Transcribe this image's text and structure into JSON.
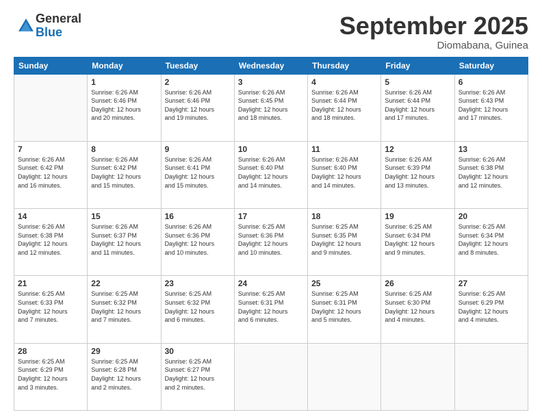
{
  "logo": {
    "general": "General",
    "blue": "Blue"
  },
  "header": {
    "month": "September 2025",
    "location": "Diomabana, Guinea"
  },
  "days_of_week": [
    "Sunday",
    "Monday",
    "Tuesday",
    "Wednesday",
    "Thursday",
    "Friday",
    "Saturday"
  ],
  "weeks": [
    [
      {
        "day": "",
        "info": ""
      },
      {
        "day": "1",
        "info": "Sunrise: 6:26 AM\nSunset: 6:46 PM\nDaylight: 12 hours\nand 20 minutes."
      },
      {
        "day": "2",
        "info": "Sunrise: 6:26 AM\nSunset: 6:46 PM\nDaylight: 12 hours\nand 19 minutes."
      },
      {
        "day": "3",
        "info": "Sunrise: 6:26 AM\nSunset: 6:45 PM\nDaylight: 12 hours\nand 18 minutes."
      },
      {
        "day": "4",
        "info": "Sunrise: 6:26 AM\nSunset: 6:44 PM\nDaylight: 12 hours\nand 18 minutes."
      },
      {
        "day": "5",
        "info": "Sunrise: 6:26 AM\nSunset: 6:44 PM\nDaylight: 12 hours\nand 17 minutes."
      },
      {
        "day": "6",
        "info": "Sunrise: 6:26 AM\nSunset: 6:43 PM\nDaylight: 12 hours\nand 17 minutes."
      }
    ],
    [
      {
        "day": "7",
        "info": "Sunrise: 6:26 AM\nSunset: 6:42 PM\nDaylight: 12 hours\nand 16 minutes."
      },
      {
        "day": "8",
        "info": "Sunrise: 6:26 AM\nSunset: 6:42 PM\nDaylight: 12 hours\nand 15 minutes."
      },
      {
        "day": "9",
        "info": "Sunrise: 6:26 AM\nSunset: 6:41 PM\nDaylight: 12 hours\nand 15 minutes."
      },
      {
        "day": "10",
        "info": "Sunrise: 6:26 AM\nSunset: 6:40 PM\nDaylight: 12 hours\nand 14 minutes."
      },
      {
        "day": "11",
        "info": "Sunrise: 6:26 AM\nSunset: 6:40 PM\nDaylight: 12 hours\nand 14 minutes."
      },
      {
        "day": "12",
        "info": "Sunrise: 6:26 AM\nSunset: 6:39 PM\nDaylight: 12 hours\nand 13 minutes."
      },
      {
        "day": "13",
        "info": "Sunrise: 6:26 AM\nSunset: 6:38 PM\nDaylight: 12 hours\nand 12 minutes."
      }
    ],
    [
      {
        "day": "14",
        "info": "Sunrise: 6:26 AM\nSunset: 6:38 PM\nDaylight: 12 hours\nand 12 minutes."
      },
      {
        "day": "15",
        "info": "Sunrise: 6:26 AM\nSunset: 6:37 PM\nDaylight: 12 hours\nand 11 minutes."
      },
      {
        "day": "16",
        "info": "Sunrise: 6:26 AM\nSunset: 6:36 PM\nDaylight: 12 hours\nand 10 minutes."
      },
      {
        "day": "17",
        "info": "Sunrise: 6:25 AM\nSunset: 6:36 PM\nDaylight: 12 hours\nand 10 minutes."
      },
      {
        "day": "18",
        "info": "Sunrise: 6:25 AM\nSunset: 6:35 PM\nDaylight: 12 hours\nand 9 minutes."
      },
      {
        "day": "19",
        "info": "Sunrise: 6:25 AM\nSunset: 6:34 PM\nDaylight: 12 hours\nand 9 minutes."
      },
      {
        "day": "20",
        "info": "Sunrise: 6:25 AM\nSunset: 6:34 PM\nDaylight: 12 hours\nand 8 minutes."
      }
    ],
    [
      {
        "day": "21",
        "info": "Sunrise: 6:25 AM\nSunset: 6:33 PM\nDaylight: 12 hours\nand 7 minutes."
      },
      {
        "day": "22",
        "info": "Sunrise: 6:25 AM\nSunset: 6:32 PM\nDaylight: 12 hours\nand 7 minutes."
      },
      {
        "day": "23",
        "info": "Sunrise: 6:25 AM\nSunset: 6:32 PM\nDaylight: 12 hours\nand 6 minutes."
      },
      {
        "day": "24",
        "info": "Sunrise: 6:25 AM\nSunset: 6:31 PM\nDaylight: 12 hours\nand 6 minutes."
      },
      {
        "day": "25",
        "info": "Sunrise: 6:25 AM\nSunset: 6:31 PM\nDaylight: 12 hours\nand 5 minutes."
      },
      {
        "day": "26",
        "info": "Sunrise: 6:25 AM\nSunset: 6:30 PM\nDaylight: 12 hours\nand 4 minutes."
      },
      {
        "day": "27",
        "info": "Sunrise: 6:25 AM\nSunset: 6:29 PM\nDaylight: 12 hours\nand 4 minutes."
      }
    ],
    [
      {
        "day": "28",
        "info": "Sunrise: 6:25 AM\nSunset: 6:29 PM\nDaylight: 12 hours\nand 3 minutes."
      },
      {
        "day": "29",
        "info": "Sunrise: 6:25 AM\nSunset: 6:28 PM\nDaylight: 12 hours\nand 2 minutes."
      },
      {
        "day": "30",
        "info": "Sunrise: 6:25 AM\nSunset: 6:27 PM\nDaylight: 12 hours\nand 2 minutes."
      },
      {
        "day": "",
        "info": ""
      },
      {
        "day": "",
        "info": ""
      },
      {
        "day": "",
        "info": ""
      },
      {
        "day": "",
        "info": ""
      }
    ]
  ]
}
